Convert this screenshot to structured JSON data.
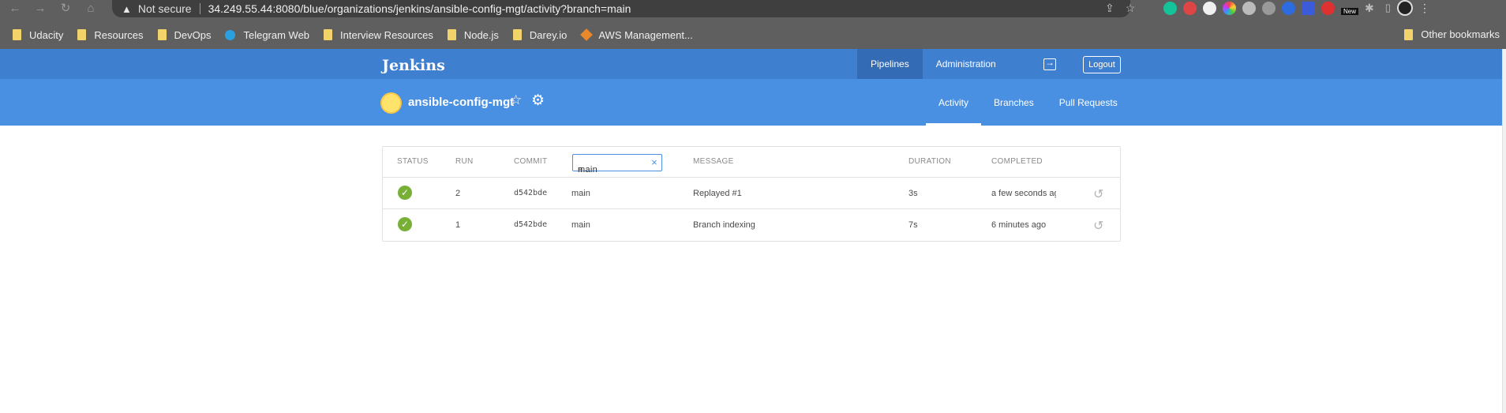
{
  "browser": {
    "security_label": "Not secure",
    "url": "34.249.55.44:8080/blue/organizations/jenkins/ansible-config-mgt/activity?branch=main",
    "extension_badge": "New",
    "bookmarks": [
      "Udacity",
      "Resources",
      "DevOps",
      "Telegram Web",
      "Interview Resources",
      "Node.js",
      "Darey.io",
      "AWS Management..."
    ],
    "other_bookmarks": "Other bookmarks"
  },
  "header": {
    "logo": "Jenkins",
    "nav": [
      "Pipelines",
      "Administration"
    ],
    "logout": "Logout"
  },
  "pipeline": {
    "name": "ansible-config-mgt",
    "tabs": [
      "Activity",
      "Branches",
      "Pull Requests"
    ]
  },
  "activity": {
    "columns": {
      "status": "STATUS",
      "run": "RUN",
      "commit": "COMMIT",
      "message": "MESSAGE",
      "duration": "DURATION",
      "completed": "COMPLETED"
    },
    "branch_filter": "main",
    "rows": [
      {
        "run": "2",
        "commit": "d542bde",
        "branch": "main",
        "message": "Replayed #1",
        "duration": "3s",
        "completed": "a few seconds ago"
      },
      {
        "run": "1",
        "commit": "d542bde",
        "branch": "main",
        "message": "Branch indexing",
        "duration": "7s",
        "completed": "6 minutes ago"
      }
    ]
  },
  "colors": {
    "header_top": "#3f7fd0",
    "header_sub": "#4a90e2",
    "success": "#78b037"
  }
}
